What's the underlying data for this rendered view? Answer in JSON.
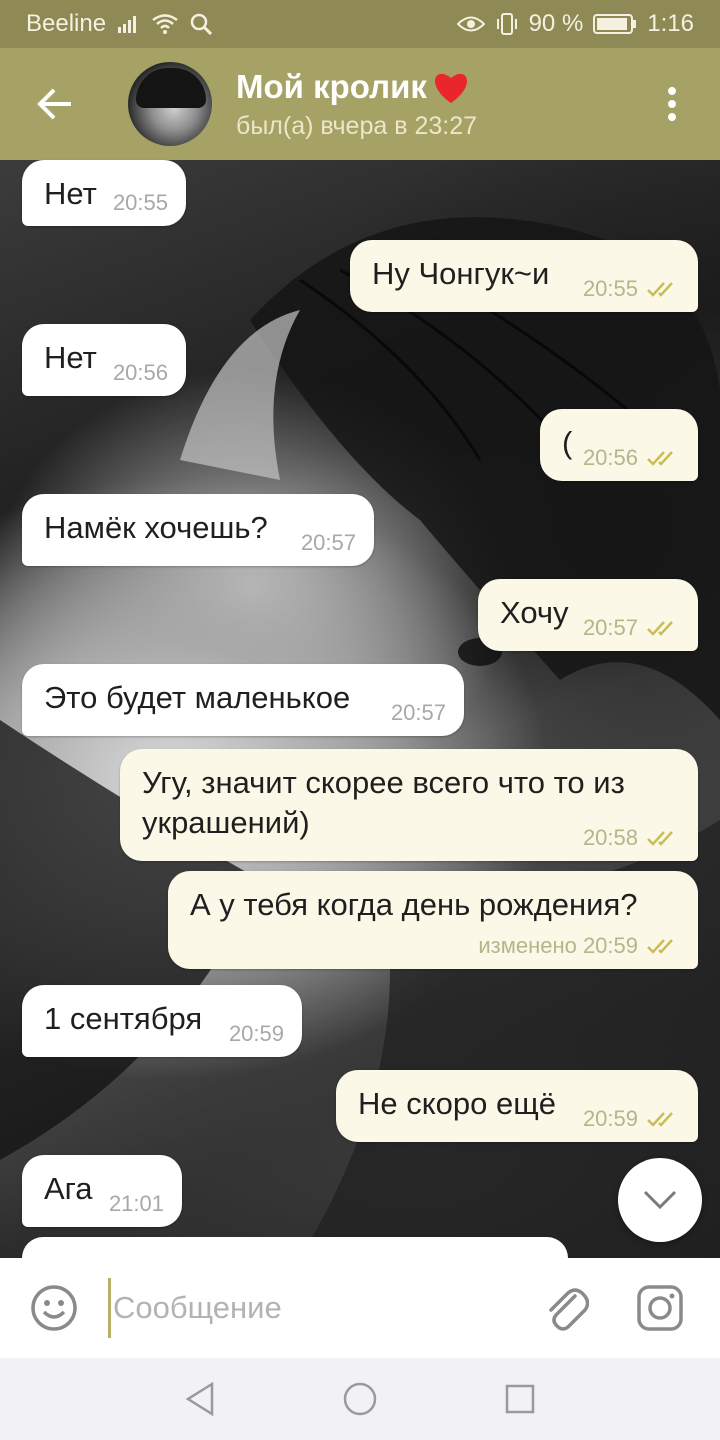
{
  "status_bar": {
    "carrier": "Beeline",
    "battery": "90 %",
    "time": "1:16",
    "icons": [
      "signal-icon",
      "wifi-icon",
      "search-icon",
      "eye-icon",
      "vibrate-icon",
      "battery-icon"
    ]
  },
  "header": {
    "name": "Мой кролик",
    "emoji": "❤️",
    "last_seen": "был(а) вчера в 23:27",
    "icons": [
      "back-arrow-icon",
      "avatar",
      "more-vert-icon"
    ]
  },
  "colors": {
    "header_bg": "#a6a164",
    "status_bg": "#8f8a55",
    "incoming_bubble": "#ffffff",
    "outgoing_bubble": "#fbf8e7",
    "check_color": "#c9bd57"
  },
  "messages": [
    {
      "dir": "in",
      "text": "Нет",
      "time": "20:55"
    },
    {
      "dir": "out",
      "text": "Ну Чонгук~и",
      "time": "20:55",
      "read": true
    },
    {
      "dir": "in",
      "text": "Нет",
      "time": "20:56"
    },
    {
      "dir": "out",
      "text": "(",
      "time": "20:56",
      "read": true
    },
    {
      "dir": "in",
      "text": "Намёк хочешь?",
      "time": "20:57"
    },
    {
      "dir": "out",
      "text": "Хочу",
      "time": "20:57",
      "read": true
    },
    {
      "dir": "in",
      "text": "Это будет маленькое",
      "time": "20:57"
    },
    {
      "dir": "out",
      "text": "Угу, значит скорее всего что то из\nукрашений)",
      "time": "20:58",
      "read": true
    },
    {
      "dir": "out",
      "text": "А у тебя когда день рождения?",
      "time": "изменено 20:59",
      "read": true
    },
    {
      "dir": "in",
      "text": "1 сентября",
      "time": "20:59"
    },
    {
      "dir": "out",
      "text": "Не скоро ещё",
      "time": "20:59",
      "read": true
    },
    {
      "dir": "in",
      "text": "Ага",
      "time": "21:01"
    }
  ],
  "input": {
    "placeholder": "Сообщение",
    "value": ""
  },
  "nav": {
    "icons": [
      "nav-back-icon",
      "nav-home-icon",
      "nav-recents-icon"
    ]
  }
}
